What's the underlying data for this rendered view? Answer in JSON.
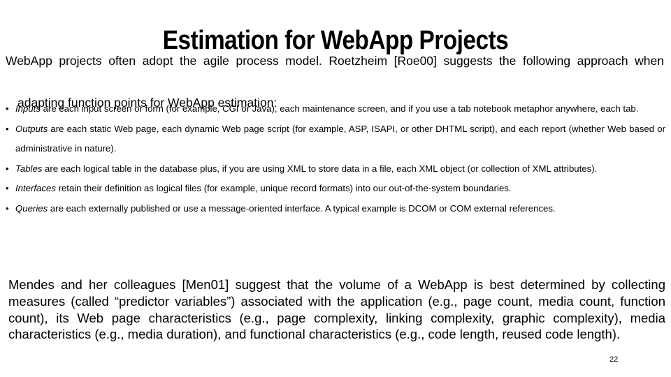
{
  "slide": {
    "title": "Estimation for WebApp Projects",
    "page_number": "22",
    "background_color": "#ffffff",
    "text_color": "#000000"
  },
  "intro": {
    "line1": "WebApp projects often adopt the agile process model. Roetzheim [Roe00] suggests the following approach when",
    "line2": "adapting function points for WebApp estimation:"
  },
  "bullets": [
    {
      "marker": "•",
      "term": "Inputs",
      "text": " are each input screen or form (for example, CGI or Java), each maintenance screen, and if you use a tab notebook metaphor anywhere, each tab."
    },
    {
      "marker": "•",
      "term": "Outputs",
      "text": " are each static Web page, each dynamic Web page script (for example, ASP, ISAPI, or other DHTML script), and each report (whether Web based or administrative in nature)."
    },
    {
      "marker": "•",
      "term": "Tables",
      "text": " are each logical table in the database plus, if you are using XML to store data in a file, each XML object (or collection of XML attributes)."
    },
    {
      "marker": "•",
      "term": "Interfaces",
      "text": " retain their definition as logical files (for example, unique record formats) into our out-of-the-system boundaries."
    },
    {
      "marker": "•",
      "term": "Queries",
      "text": " are each externally published or use a message-oriented interface. A typical example is DCOM or COM external references."
    }
  ],
  "closing": {
    "text": "Mendes and her colleagues [Men01] suggest that the volume of a WebApp is best determined by collecting measures (called “predictor variables”) associated with the application (e.g., page count, media count, function count), its Web page characteristics (e.g., page complexity, linking complexity, graphic complexity), media characteristics (e.g., media duration), and functional characteristics (e.g., code length, reused code length)."
  }
}
